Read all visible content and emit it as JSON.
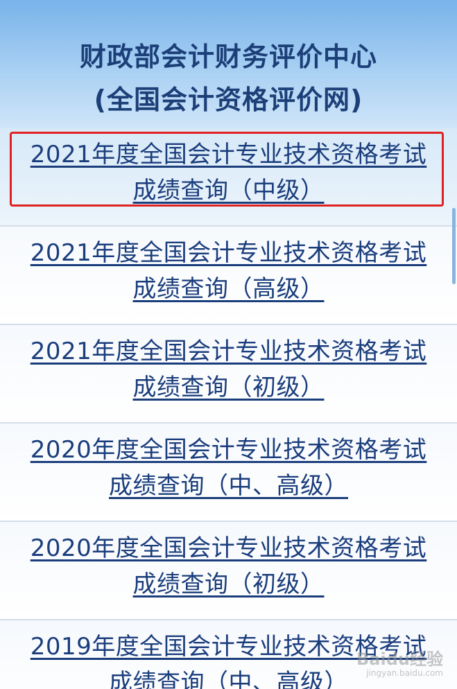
{
  "header": {
    "title_line1": "财政部会计财务评价中心",
    "title_line2": "(全国会计资格评价网)"
  },
  "items": [
    {
      "line1": "2021年度全国会计专业技术资格考试",
      "line2": "成绩查询（中级）"
    },
    {
      "line1": "2021年度全国会计专业技术资格考试",
      "line2": "成绩查询（高级）"
    },
    {
      "line1": "2021年度全国会计专业技术资格考试",
      "line2": "成绩查询（初级）"
    },
    {
      "line1": "2020年度全国会计专业技术资格考试",
      "line2": "成绩查询（中、高级）"
    },
    {
      "line1": "2020年度全国会计专业技术资格考试",
      "line2": "成绩查询（初级）"
    },
    {
      "line1": "2019年度全国会计专业技术资格考试",
      "line2": "成绩查询（中、高级）"
    }
  ],
  "watermark": {
    "main": "Baidu经验",
    "sub": "jingyan.baidu.com"
  },
  "colors": {
    "link": "#1a3d7c",
    "title": "#1c3f78",
    "highlight": "#e02020"
  }
}
